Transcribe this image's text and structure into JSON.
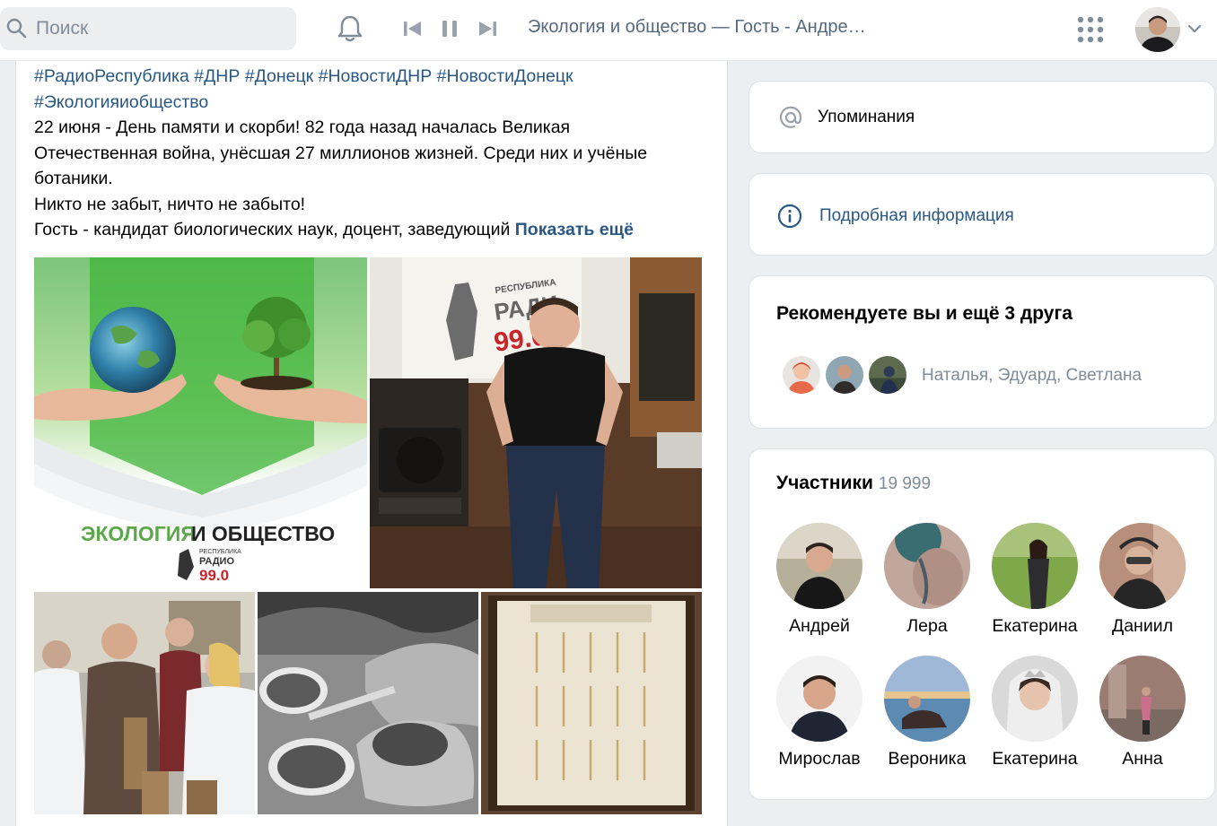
{
  "header": {
    "search_placeholder": "Поиск",
    "now_playing": "Экология и общество — Гость - Андре…",
    "icons": [
      "search-icon",
      "bell-icon",
      "previous-track-icon",
      "pause-icon",
      "next-track-icon",
      "apps-grid-icon",
      "chevron-down-icon"
    ]
  },
  "post": {
    "hashtags_line1": "#РадиоРеспублика #ДНР #Донецк #НовостиДНР #НовостиДонецк",
    "hashtags_line2": "#Экологияиобщество",
    "text_line1": "22 июня - День памяти и скорби! 82 года назад началась Великая",
    "text_line2": "Отечественная война, унёсшая 27 миллионов жизней. Среди них и учёные",
    "text_line3": "ботаники.",
    "text_line4": "Никто не забыт, ничто не забыто!",
    "text_line5": "Гость - кандидат биологических наук, доцент, заведующий",
    "show_more": "Показать ещё",
    "poster_title_green": "ЭКОЛОГИЯ",
    "poster_title_dark": "И ОБЩЕСТВО",
    "poster_logo_top": "РЕСПУБЛИКА",
    "poster_logo_mid": "РАДИО",
    "poster_logo_freq": "99.0",
    "banner_text_1": "РЕСПУБЛИКА",
    "banner_text_2": "РАДИ",
    "banner_text_3": "99.0"
  },
  "sidebar": {
    "mentions_label": "Упоминания",
    "info_label": "Подробная информация",
    "recommend_title": "Рекомендуете вы и ещё 3 друга",
    "recommend_names": "Наталья, Эдуард, Светлана",
    "members_title": "Участники",
    "members_count": "19 999",
    "members": [
      {
        "name": "Андрей"
      },
      {
        "name": "Лера"
      },
      {
        "name": "Екатерина"
      },
      {
        "name": "Даниил"
      },
      {
        "name": "Мирослав"
      },
      {
        "name": "Вероника"
      },
      {
        "name": "Екатерина"
      },
      {
        "name": "Анна"
      }
    ]
  },
  "colors": {
    "link": "#2a5885",
    "muted": "#818c99",
    "background": "#edeef0",
    "poster_green": "#4caf3f"
  }
}
